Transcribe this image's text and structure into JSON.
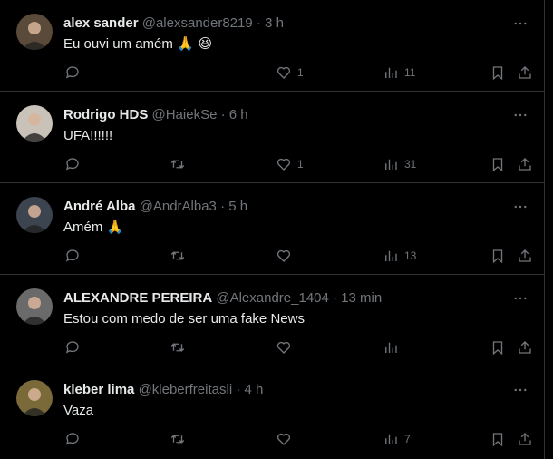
{
  "replies": [
    {
      "name": "alex sander",
      "handle": "@alexsander8219",
      "dot": "·",
      "time": "3 h",
      "text": "Eu ouvi um amém",
      "emoji": "🙏 😆",
      "counts": {
        "replies": "",
        "retweets": "",
        "likes": "1",
        "views": "11"
      },
      "avatar_color": "#5a4a3a",
      "retweet_visible": false
    },
    {
      "name": "Rodrigo HDS",
      "handle": "@HaiekSe",
      "dot": "·",
      "time": "6 h",
      "text": "UFA!!!!!!",
      "emoji": "",
      "counts": {
        "replies": "",
        "retweets": "",
        "likes": "1",
        "views": "31"
      },
      "avatar_color": "#c9c2b8",
      "retweet_visible": true
    },
    {
      "name": "André Alba",
      "handle": "@AndrAlba3",
      "dot": "·",
      "time": "5 h",
      "text": "Amém",
      "emoji": "🙏",
      "counts": {
        "replies": "",
        "retweets": "",
        "likes": "",
        "views": "13"
      },
      "avatar_color": "#3c4450",
      "retweet_visible": true
    },
    {
      "name": "ALEXANDRE PEREIRA",
      "handle": "@Alexandre_1404",
      "dot": "·",
      "time": "13 min",
      "text": "Estou com medo de ser uma fake News",
      "emoji": "",
      "counts": {
        "replies": "",
        "retweets": "",
        "likes": "",
        "views": ""
      },
      "avatar_color": "#6a6a6a",
      "retweet_visible": true
    },
    {
      "name": "kleber lima",
      "handle": "@kleberfreitasli",
      "dot": "·",
      "time": "4 h",
      "text": "Vaza",
      "emoji": "",
      "counts": {
        "replies": "",
        "retweets": "",
        "likes": "",
        "views": "7"
      },
      "avatar_color": "#7a6a3a",
      "retweet_visible": true
    }
  ],
  "colors": {
    "background": "#000000",
    "text_primary": "#e7e9ea",
    "text_secondary": "#71767b",
    "divider": "#2f3336"
  }
}
